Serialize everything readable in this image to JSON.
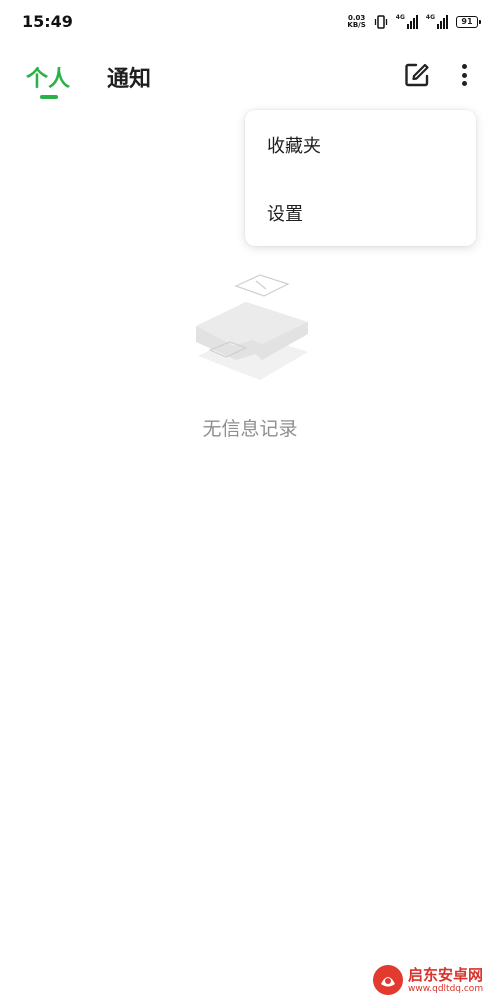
{
  "status_bar": {
    "time": "15:49",
    "net_speed_value": "0.03",
    "net_speed_unit": "KB/S",
    "signal_1_label": "4G",
    "signal_2_label": "4G",
    "battery": "91"
  },
  "header": {
    "tabs": [
      {
        "label": "个人",
        "active": true
      },
      {
        "label": "通知",
        "active": false
      }
    ],
    "accent_color": "#2bb14a"
  },
  "menu": {
    "items": [
      {
        "label": "收藏夹"
      },
      {
        "label": "设置"
      }
    ]
  },
  "empty_state": {
    "text": "无信息记录"
  },
  "watermark": {
    "title": "启东安卓网",
    "url": "www.qdltdq.com"
  }
}
